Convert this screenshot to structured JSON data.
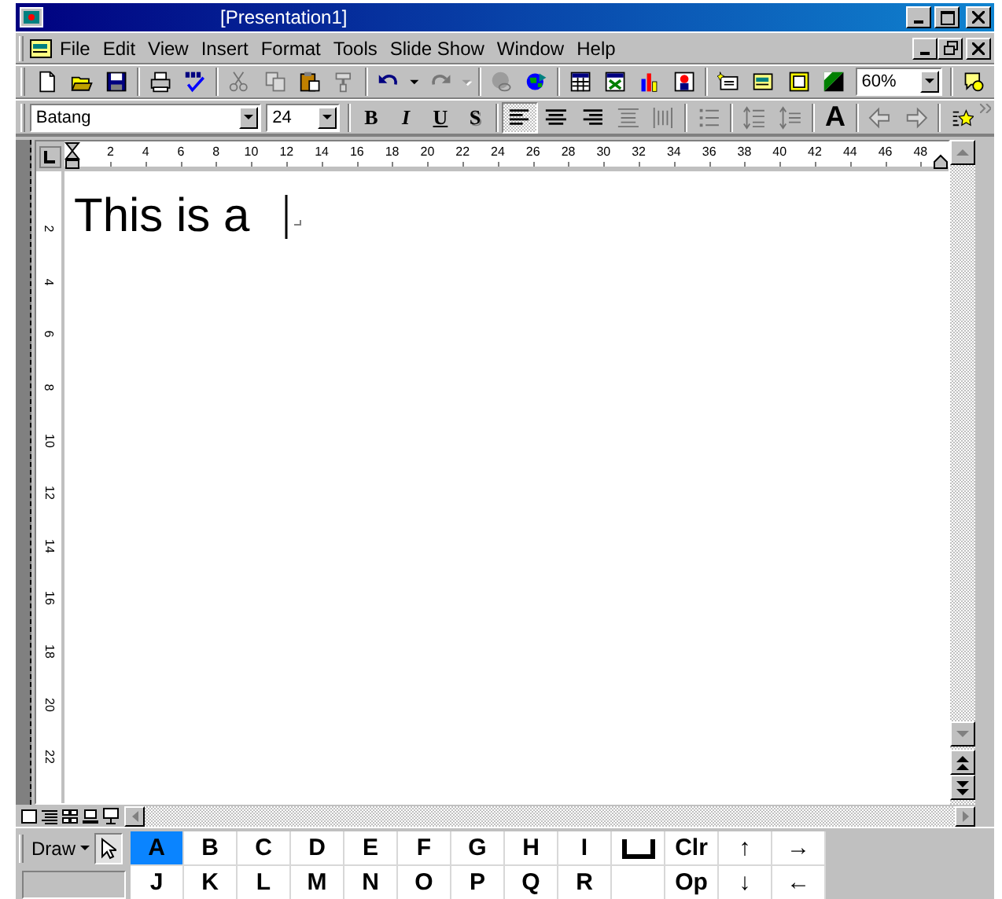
{
  "window": {
    "title": "[Presentation1]"
  },
  "menu": [
    "File",
    "Edit",
    "View",
    "Insert",
    "Format",
    "Tools",
    "Slide Show",
    "Window",
    "Help"
  ],
  "standard_toolbar": [
    [
      {
        "kind": "new",
        "disabled": false
      },
      {
        "kind": "open",
        "disabled": false
      },
      {
        "kind": "save",
        "disabled": false
      }
    ],
    [
      {
        "kind": "print",
        "disabled": false
      },
      {
        "kind": "spelling",
        "disabled": false
      }
    ],
    [
      {
        "kind": "cut",
        "disabled": true
      },
      {
        "kind": "copy",
        "disabled": true
      },
      {
        "kind": "paste",
        "disabled": false
      },
      {
        "kind": "painter",
        "disabled": true
      }
    ],
    [
      {
        "kind": "undo",
        "disabled": false
      },
      {
        "kind": "caret",
        "disabled": false
      },
      {
        "kind": "redo",
        "disabled": true
      },
      {
        "kind": "caret",
        "disabled": true
      }
    ],
    [
      {
        "kind": "hyperlink",
        "disabled": true
      },
      {
        "kind": "web",
        "disabled": false
      }
    ],
    [
      {
        "kind": "table",
        "disabled": false
      },
      {
        "kind": "sheet",
        "disabled": false
      },
      {
        "kind": "chart",
        "disabled": false
      },
      {
        "kind": "clipart",
        "disabled": false
      }
    ],
    [
      {
        "kind": "newslide",
        "disabled": false
      },
      {
        "kind": "layout",
        "disabled": false
      },
      {
        "kind": "background",
        "disabled": false
      },
      {
        "kind": "grayscale",
        "disabled": false
      },
      {
        "kind": "zoom",
        "value": "60%",
        "disabled": false
      }
    ],
    [
      {
        "kind": "help",
        "disabled": false
      }
    ]
  ],
  "formatting_toolbar": [
    [
      {
        "kind": "font",
        "value": "Batang"
      },
      {
        "kind": "size",
        "value": "24"
      }
    ],
    [
      {
        "kind": "bold",
        "label": "B",
        "pressed": false,
        "disabled": false
      },
      {
        "kind": "italic",
        "label": "I",
        "pressed": false,
        "disabled": false
      },
      {
        "kind": "underline",
        "label": "U",
        "pressed": false,
        "disabled": false
      },
      {
        "kind": "shadow",
        "label": "S",
        "pressed": false,
        "disabled": false
      }
    ],
    [
      {
        "kind": "align-left",
        "pressed": true,
        "disabled": false
      },
      {
        "kind": "align-center",
        "pressed": false,
        "disabled": false
      },
      {
        "kind": "align-right",
        "pressed": false,
        "disabled": false
      },
      {
        "kind": "distribute-v",
        "pressed": false,
        "disabled": true
      },
      {
        "kind": "distribute-h",
        "pressed": false,
        "disabled": true
      }
    ],
    [
      {
        "kind": "bullets",
        "pressed": false,
        "disabled": true
      }
    ],
    [
      {
        "kind": "spacing-up",
        "pressed": false,
        "disabled": true
      },
      {
        "kind": "spacing-down",
        "pressed": false,
        "disabled": true
      }
    ],
    [
      {
        "kind": "grow",
        "label": "A",
        "pressed": false,
        "disabled": false
      }
    ],
    [
      {
        "kind": "promote",
        "pressed": false,
        "disabled": true
      },
      {
        "kind": "demote",
        "pressed": false,
        "disabled": true
      }
    ],
    [
      {
        "kind": "animation",
        "pressed": false,
        "disabled": false
      }
    ]
  ],
  "rulers": {
    "horizontal": [
      "2",
      "4",
      "6",
      "8",
      "10",
      "12",
      "14",
      "16",
      "18",
      "20",
      "22",
      "24",
      "26",
      "28",
      "30",
      "32",
      "34",
      "36",
      "38",
      "40",
      "42",
      "44",
      "46",
      "48"
    ],
    "vertical": [
      "2",
      "4",
      "6",
      "8",
      "10",
      "12",
      "14",
      "16",
      "18",
      "20",
      "22"
    ]
  },
  "document": {
    "text": "This is a"
  },
  "draw_button": "Draw",
  "keys": [
    {
      "kind": "char",
      "label": "A",
      "selected": true
    },
    {
      "kind": "char",
      "label": "B",
      "selected": false
    },
    {
      "kind": "char",
      "label": "C",
      "selected": false
    },
    {
      "kind": "char",
      "label": "D",
      "selected": false
    },
    {
      "kind": "char",
      "label": "E",
      "selected": false
    },
    {
      "kind": "char",
      "label": "F",
      "selected": false
    },
    {
      "kind": "char",
      "label": "G",
      "selected": false
    },
    {
      "kind": "char",
      "label": "H",
      "selected": false
    },
    {
      "kind": "char",
      "label": "I",
      "selected": false
    },
    {
      "kind": "space",
      "selected": false
    },
    {
      "kind": "char",
      "label": "Clr",
      "selected": false
    },
    {
      "kind": "char",
      "label": "↑",
      "selected": false
    },
    {
      "kind": "char",
      "label": "→",
      "selected": false
    },
    {
      "kind": "char",
      "label": "J",
      "selected": false
    },
    {
      "kind": "char",
      "label": "K",
      "selected": false
    },
    {
      "kind": "char",
      "label": "L",
      "selected": false
    },
    {
      "kind": "char",
      "label": "M",
      "selected": false
    },
    {
      "kind": "char",
      "label": "N",
      "selected": false
    },
    {
      "kind": "char",
      "label": "O",
      "selected": false
    },
    {
      "kind": "char",
      "label": "P",
      "selected": false
    },
    {
      "kind": "char",
      "label": "Q",
      "selected": false
    },
    {
      "kind": "char",
      "label": "R",
      "selected": false
    },
    {
      "kind": "blank",
      "selected": false
    },
    {
      "kind": "char",
      "label": "Op",
      "selected": false
    },
    {
      "kind": "char",
      "label": "↓",
      "selected": false
    },
    {
      "kind": "char",
      "label": "←",
      "selected": false
    }
  ]
}
